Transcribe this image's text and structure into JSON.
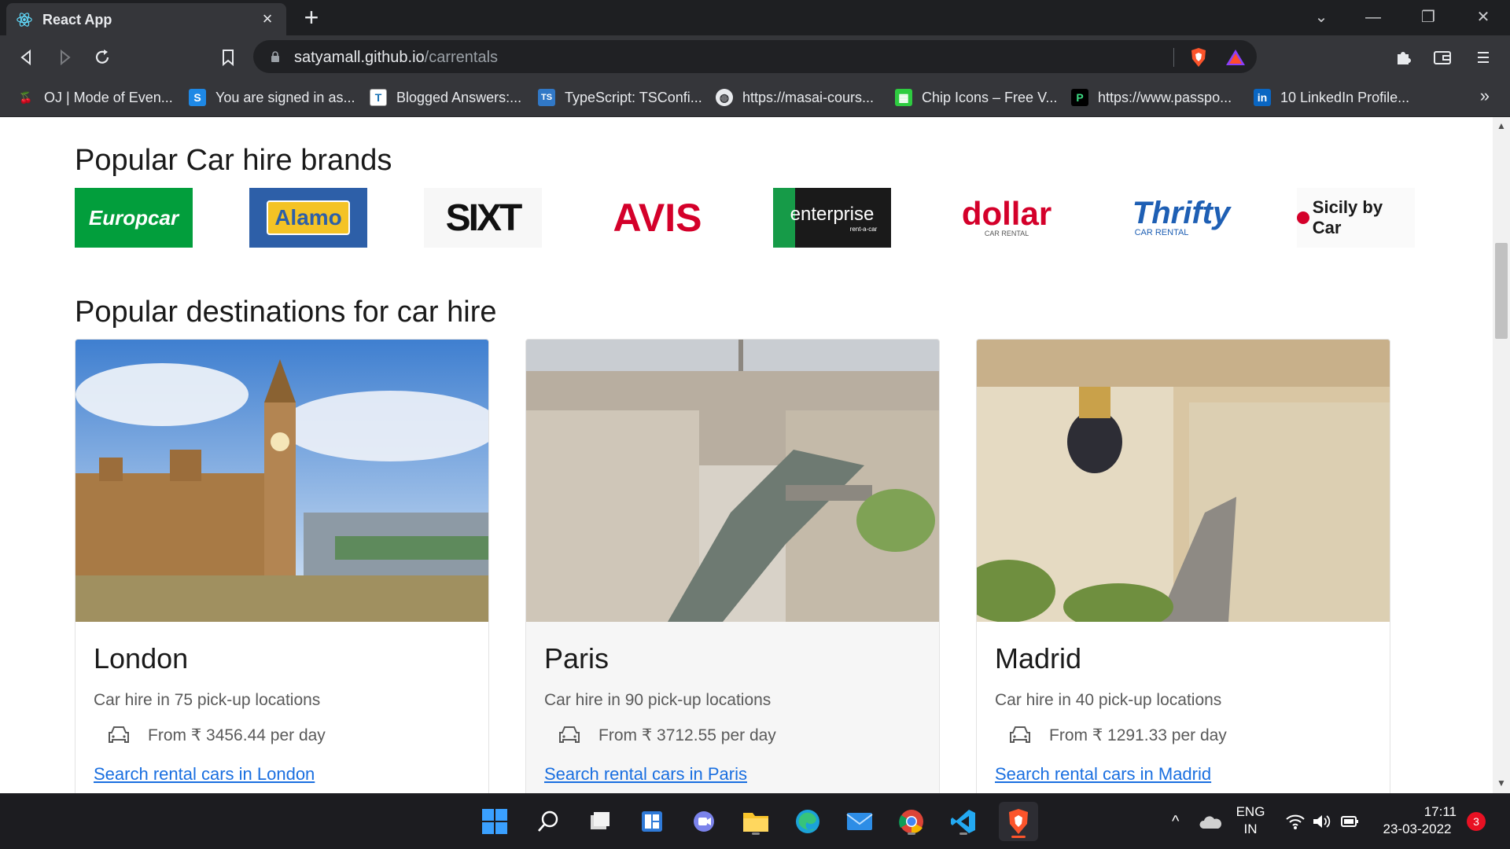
{
  "browser": {
    "tab_title": "React App",
    "url_host": "satyamall.github.io",
    "url_path": "/carrentals",
    "bookmarks": [
      {
        "label": "OJ | Mode of Even...",
        "icon": "cherry-icon"
      },
      {
        "label": "You are signed in as...",
        "icon": "s-logo-icon"
      },
      {
        "label": "Blogged Answers:...",
        "icon": "blog-icon"
      },
      {
        "label": "TypeScript: TSConfi...",
        "icon": "typescript-icon"
      },
      {
        "label": "https://masai-cours...",
        "icon": "globe-icon"
      },
      {
        "label": "Chip Icons – Free V...",
        "icon": "chip-icon"
      },
      {
        "label": "https://www.passpo...",
        "icon": "passport-icon"
      },
      {
        "label": "10 LinkedIn Profile...",
        "icon": "linkedin-icon"
      }
    ]
  },
  "page": {
    "brands_title": "Popular Car hire brands",
    "brands": [
      {
        "name": "Europcar"
      },
      {
        "name": "Alamo"
      },
      {
        "name": "SIXT"
      },
      {
        "name": "AVIS"
      },
      {
        "name": "enterprise",
        "sub": "rent-a-car"
      },
      {
        "name": "dollar",
        "sub": "CAR RENTAL"
      },
      {
        "name": "Thrifty",
        "sub": "CAR RENTAL"
      },
      {
        "name": "Sicily by Car"
      }
    ],
    "destinations_title": "Popular destinations for car hire",
    "destinations": [
      {
        "city": "London",
        "locations": "Car hire in 75 pick-up locations",
        "price": "From ₹ 3456.44 per day",
        "link": "Search rental cars in London"
      },
      {
        "city": "Paris",
        "locations": "Car hire in 90 pick-up locations",
        "price": "From ₹ 3712.55 per day",
        "link": "Search rental cars in Paris"
      },
      {
        "city": "Madrid",
        "locations": "Car hire in 40 pick-up locations",
        "price": "From ₹ 1291.33 per day",
        "link": "Search rental cars in Madrid"
      }
    ]
  },
  "taskbar": {
    "lang_line1": "ENG",
    "lang_line2": "IN",
    "time": "17:11",
    "date": "23-03-2022",
    "notification_count": "3"
  }
}
